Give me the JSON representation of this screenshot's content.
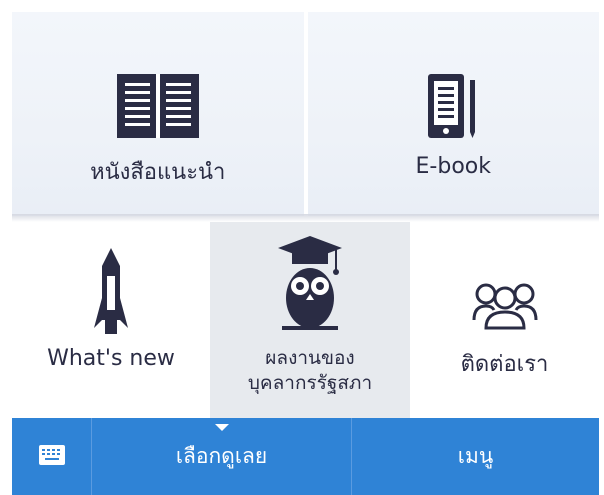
{
  "tiles_top": [
    {
      "label": "หนังสือแนะนำ",
      "icon": "open-book-icon"
    },
    {
      "label": "E-book",
      "icon": "ebook-reader-icon"
    }
  ],
  "tiles_mid": [
    {
      "label": "What's new",
      "icon": "rocket-icon"
    },
    {
      "label_line1": "ผลงานของ",
      "label_line2": "บุคลากรรัฐสภา",
      "icon": "graduate-owl-icon",
      "selected": true
    },
    {
      "label": "ติดต่อเรา",
      "icon": "people-group-icon"
    }
  ],
  "bottom_bar": {
    "keyboard_icon": "keyboard-icon",
    "primary_label": "เลือกดูเลย",
    "menu_label": "เมนู"
  },
  "colors": {
    "navy": "#2a2c44",
    "bar_blue": "#2f83d6",
    "selected_tile": "#e7eaee"
  }
}
